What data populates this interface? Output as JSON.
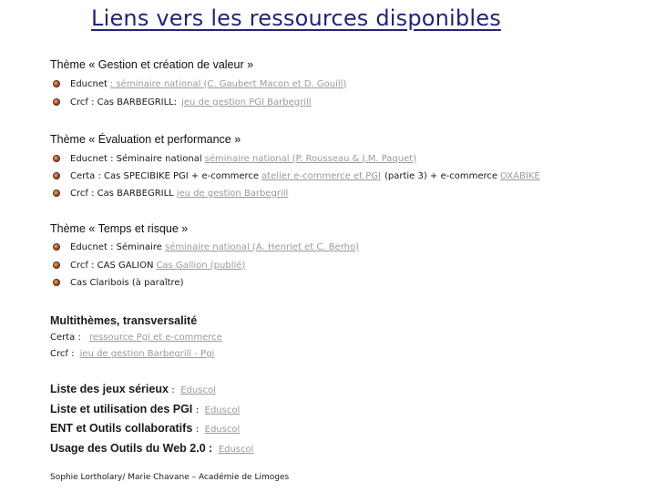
{
  "title": "Liens vers les ressources disponibles",
  "section1": {
    "heading": "Thème « Gestion et création de valeur »",
    "items": [
      {
        "text": "Educnet",
        "link": ": séminaire national (C. Gaubert Macon et D. Gouill)",
        "after": ""
      },
      {
        "text": "Crcf : Cas BARBEGRILL:",
        "link": "jeu de gestion PGI Barbegrill",
        "after": ""
      }
    ]
  },
  "section2": {
    "heading": "Thème «  Évaluation et performance »",
    "items": [
      {
        "text": "Educnet : Séminaire national",
        "link": "séminaire national (P. Rousseau & J.M. Paquet)"
      },
      {
        "text": "Certa : Cas SPECIBIKE PGI + e-commerce",
        "link": "atelier e-commerce et PGI",
        "after": "(partie 3)  +  e-commerce",
        "link2": "OXABIKE"
      },
      {
        "text": "Crcf : Cas BARBEGRILL",
        "link": "jeu de gestion Barbegrill"
      }
    ]
  },
  "section3": {
    "heading": "Thème « Temps et risque »",
    "items": [
      {
        "text": "Educnet : Séminaire",
        "link": "séminaire national (A. Henriet et C. Berho)"
      },
      {
        "text": "Crcf : CAS GALION",
        "link": "Cas Gallion (publié)"
      },
      {
        "text": "Cas Claribois (à paraître)",
        "link": ""
      }
    ]
  },
  "multi": {
    "heading": "Multithèmes, transversalité",
    "certa_label": "Certa :",
    "certa_link": "ressource Pgi et e-commerce",
    "crcf_label": "Crcf :",
    "crcf_link": "jeu de gestion Barbegrill - Pgi"
  },
  "lists": [
    {
      "label": "Liste des jeux sérieux",
      "suffix": ":",
      "link": "Eduscol"
    },
    {
      "label": "Liste et utilisation des PGI",
      "suffix": ":",
      "link": "Eduscol"
    },
    {
      "label": "ENT et Outils collaboratifs",
      "suffix": ":",
      "link": "Eduscol"
    },
    {
      "label": "Usage des Outils du Web 2.0 :",
      "suffix": "",
      "link": "Eduscol"
    }
  ],
  "footer": "Sophie Lortholary/ Marie Chavane – Académie de Limoges",
  "colors": {
    "title": "#23237a",
    "link": "#9a9a9a",
    "bullet": "#8a3a1a"
  }
}
